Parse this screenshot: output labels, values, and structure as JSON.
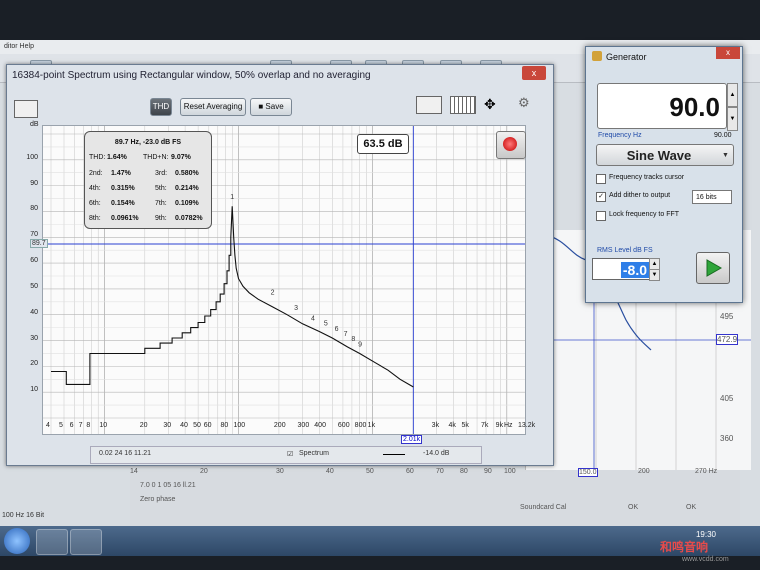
{
  "background_app": {
    "menubar_text": "ditor  Help",
    "right_tick_labels": [
      "495",
      "472.9",
      "405",
      "360"
    ],
    "lower_labels": [
      "14",
      "20",
      "30",
      "40",
      "50",
      "60",
      "70",
      "80",
      "90",
      "100",
      "150.0",
      "200",
      "270 Hz"
    ],
    "status_text": "7.0 0 1 05 16 ll.21",
    "zero_phase_label": "Zero phase",
    "soundcard_label": "Soundcard Cal",
    "bottom_left": "100 Hz   16 Bit",
    "ok_labels": [
      "OK",
      "OK"
    ]
  },
  "spectrum_window": {
    "title": "16384-point Spectrum using Rectangular window, 50% overlap and no averaging",
    "close_label": "x",
    "toolbar": {
      "thd_label": "THD",
      "reset_label": "Reset Averaging",
      "save_label": "Save"
    },
    "y_unit": "dB",
    "y_ticks": [
      "100",
      "90",
      "80",
      "70",
      "60",
      "50",
      "40",
      "30",
      "20",
      "10"
    ],
    "x_ticks": [
      "4",
      "5",
      "6",
      "7",
      "8",
      "10",
      "20",
      "30",
      "40",
      "50",
      "60",
      "80",
      "100",
      "200",
      "300",
      "400",
      "600",
      "800",
      "1k",
      "3k",
      "4k",
      "5k",
      "7k",
      "9k",
      "13.2k",
      "Hz"
    ],
    "ref_label": "89.7",
    "cursor_freq_label": "2.01k",
    "level_readout": "63.5 dB",
    "thd": {
      "header": "89.7 Hz, -23.0 dB FS",
      "thd_label": "THD:",
      "thd_value": "1.64%",
      "thdn_label": "THD+N:",
      "thdn_value": "9.07%",
      "rows": [
        {
          "l1": "2nd:",
          "v1": "1.47%",
          "l2": "3rd:",
          "v2": "0.580%"
        },
        {
          "l1": "4th:",
          "v1": "0.315%",
          "l2": "5th:",
          "v2": "0.214%"
        },
        {
          "l1": "6th:",
          "v1": "0.154%",
          "l2": "7th:",
          "v2": "0.109%"
        },
        {
          "l1": "8th:",
          "v1": "0.0961%",
          "l2": "9th:",
          "v2": "0.0782%"
        }
      ]
    },
    "harmonic_labels": [
      "1",
      "2",
      "3",
      "4",
      "5",
      "6",
      "7",
      "8",
      "9"
    ],
    "legend": {
      "trace_label": "Spectrum",
      "level_label": "-14.0 dB",
      "status": "0.02 24 16 11.21"
    }
  },
  "generator": {
    "title": "Generator",
    "close_label": "x",
    "frequency_display": "90.0",
    "frequency_label": "Frequency Hz",
    "frequency_small": "90.00",
    "waveform": "Sine Wave",
    "opt_tracks": "Frequency tracks cursor",
    "opt_dither": "Add dither to output",
    "bits": "16 bits",
    "opt_lock": "Lock frequency to FFT",
    "rms_label": "RMS Level dB FS",
    "rms_value": "-8.0"
  },
  "taskbar": {
    "clock": "19:30"
  },
  "watermark": {
    "text": "和鸣音响",
    "url": "www.vcdd.com"
  },
  "colors": {
    "accent_blue": "#1f4aa8",
    "record_red": "#c40000",
    "cursor_blue": "#2a3fd1"
  }
}
